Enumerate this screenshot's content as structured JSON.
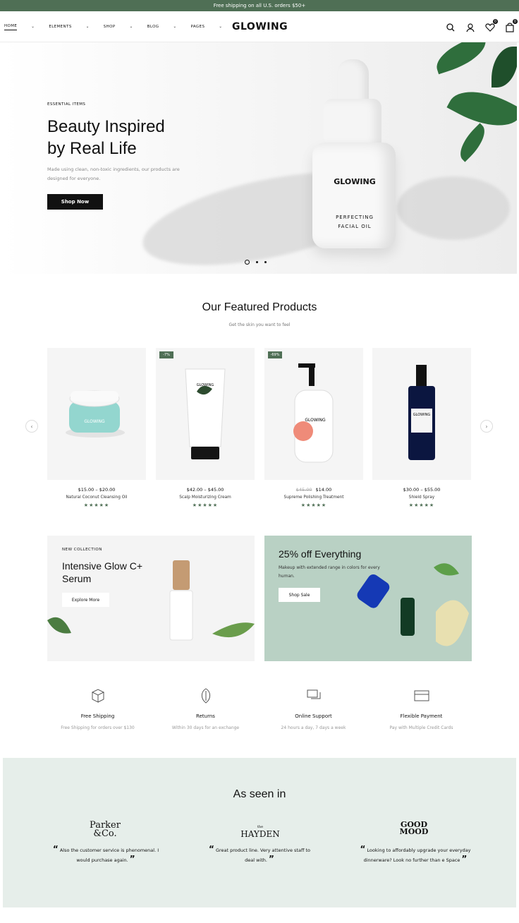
{
  "topbar": {
    "text": "Free shipping on all U.S. orders $50+"
  },
  "nav": {
    "menu": [
      {
        "label": "HOME"
      },
      {
        "label": "ELEMENTS"
      },
      {
        "label": "SHOP"
      },
      {
        "label": "BLOG"
      },
      {
        "label": "PAGES"
      }
    ],
    "logo": "GLOWING",
    "wishlist_count": "0",
    "cart_count": "0"
  },
  "hero": {
    "eyebrow": "ESSENTIAL ITEMS",
    "title_line1": "Beauty Inspired",
    "title_line2": "by Real Life",
    "description": "Made using clean, non-toxic ingredients, our products are designed for everyone.",
    "button": "Shop Now",
    "product_logo": "GLOWING",
    "product_sub_line1": "PERFECTING",
    "product_sub_line2": "FACIAL OIL"
  },
  "featured": {
    "title": "Our Featured Products",
    "subtitle": "Get the skin you want to feel",
    "products": [
      {
        "price": "$15.00 – $20.00",
        "name": "Natural Coconut Cleansing Oil",
        "old_price": "",
        "badge": "",
        "stars": "★★★★★"
      },
      {
        "price": "$42.00 – $45.00",
        "name": "Scalp Moisturizing Cream",
        "old_price": "",
        "badge": "-7%",
        "stars": "★★★★★"
      },
      {
        "price": "$14.00",
        "name": "Supreme Polishing Treatment",
        "old_price": "$45.00",
        "badge": "-69%",
        "stars": "★★★★★"
      },
      {
        "price": "$30.00 – $55.00",
        "name": "Shield Spray",
        "old_price": "",
        "badge": "",
        "stars": "★★★★★"
      }
    ]
  },
  "promos": {
    "left": {
      "eyebrow": "NEW COLLECTION",
      "title": "Intensive Glow C+ Serum",
      "button": "Explore More"
    },
    "right": {
      "title": "25% off Everything",
      "description": "Makeup with extended range in colors for every human.",
      "button": "Shop Sale"
    }
  },
  "features": [
    {
      "title": "Free Shipping",
      "desc": "Free Shipping for orders over $130"
    },
    {
      "title": "Returns",
      "desc": "Within 30 days for an exchange"
    },
    {
      "title": "Online Support",
      "desc": "24 hours a day, 7 days a week"
    },
    {
      "title": "Flexible Payment",
      "desc": "Pay with Multiple Credit Cards"
    }
  ],
  "seen": {
    "title": "As seen in",
    "brands": [
      {
        "name_line1": "Parker",
        "name_line2": "&Co.",
        "quote": "Also the customer service is phenomenal. I would purchase again."
      },
      {
        "name_line1": "the",
        "name_line2": "HAYDEN",
        "quote": "Great product line. Very attentive staff to deal with."
      },
      {
        "name_line1": "GOOD",
        "name_line2": "MOOD",
        "quote": "Looking to affordably upgrade your everyday dinnerware? Look no further than e Space"
      }
    ]
  },
  "colors": {
    "accent": "#4f6f55",
    "seen_bg": "#e6eeea",
    "promo_bg": "#b9d1c4"
  }
}
